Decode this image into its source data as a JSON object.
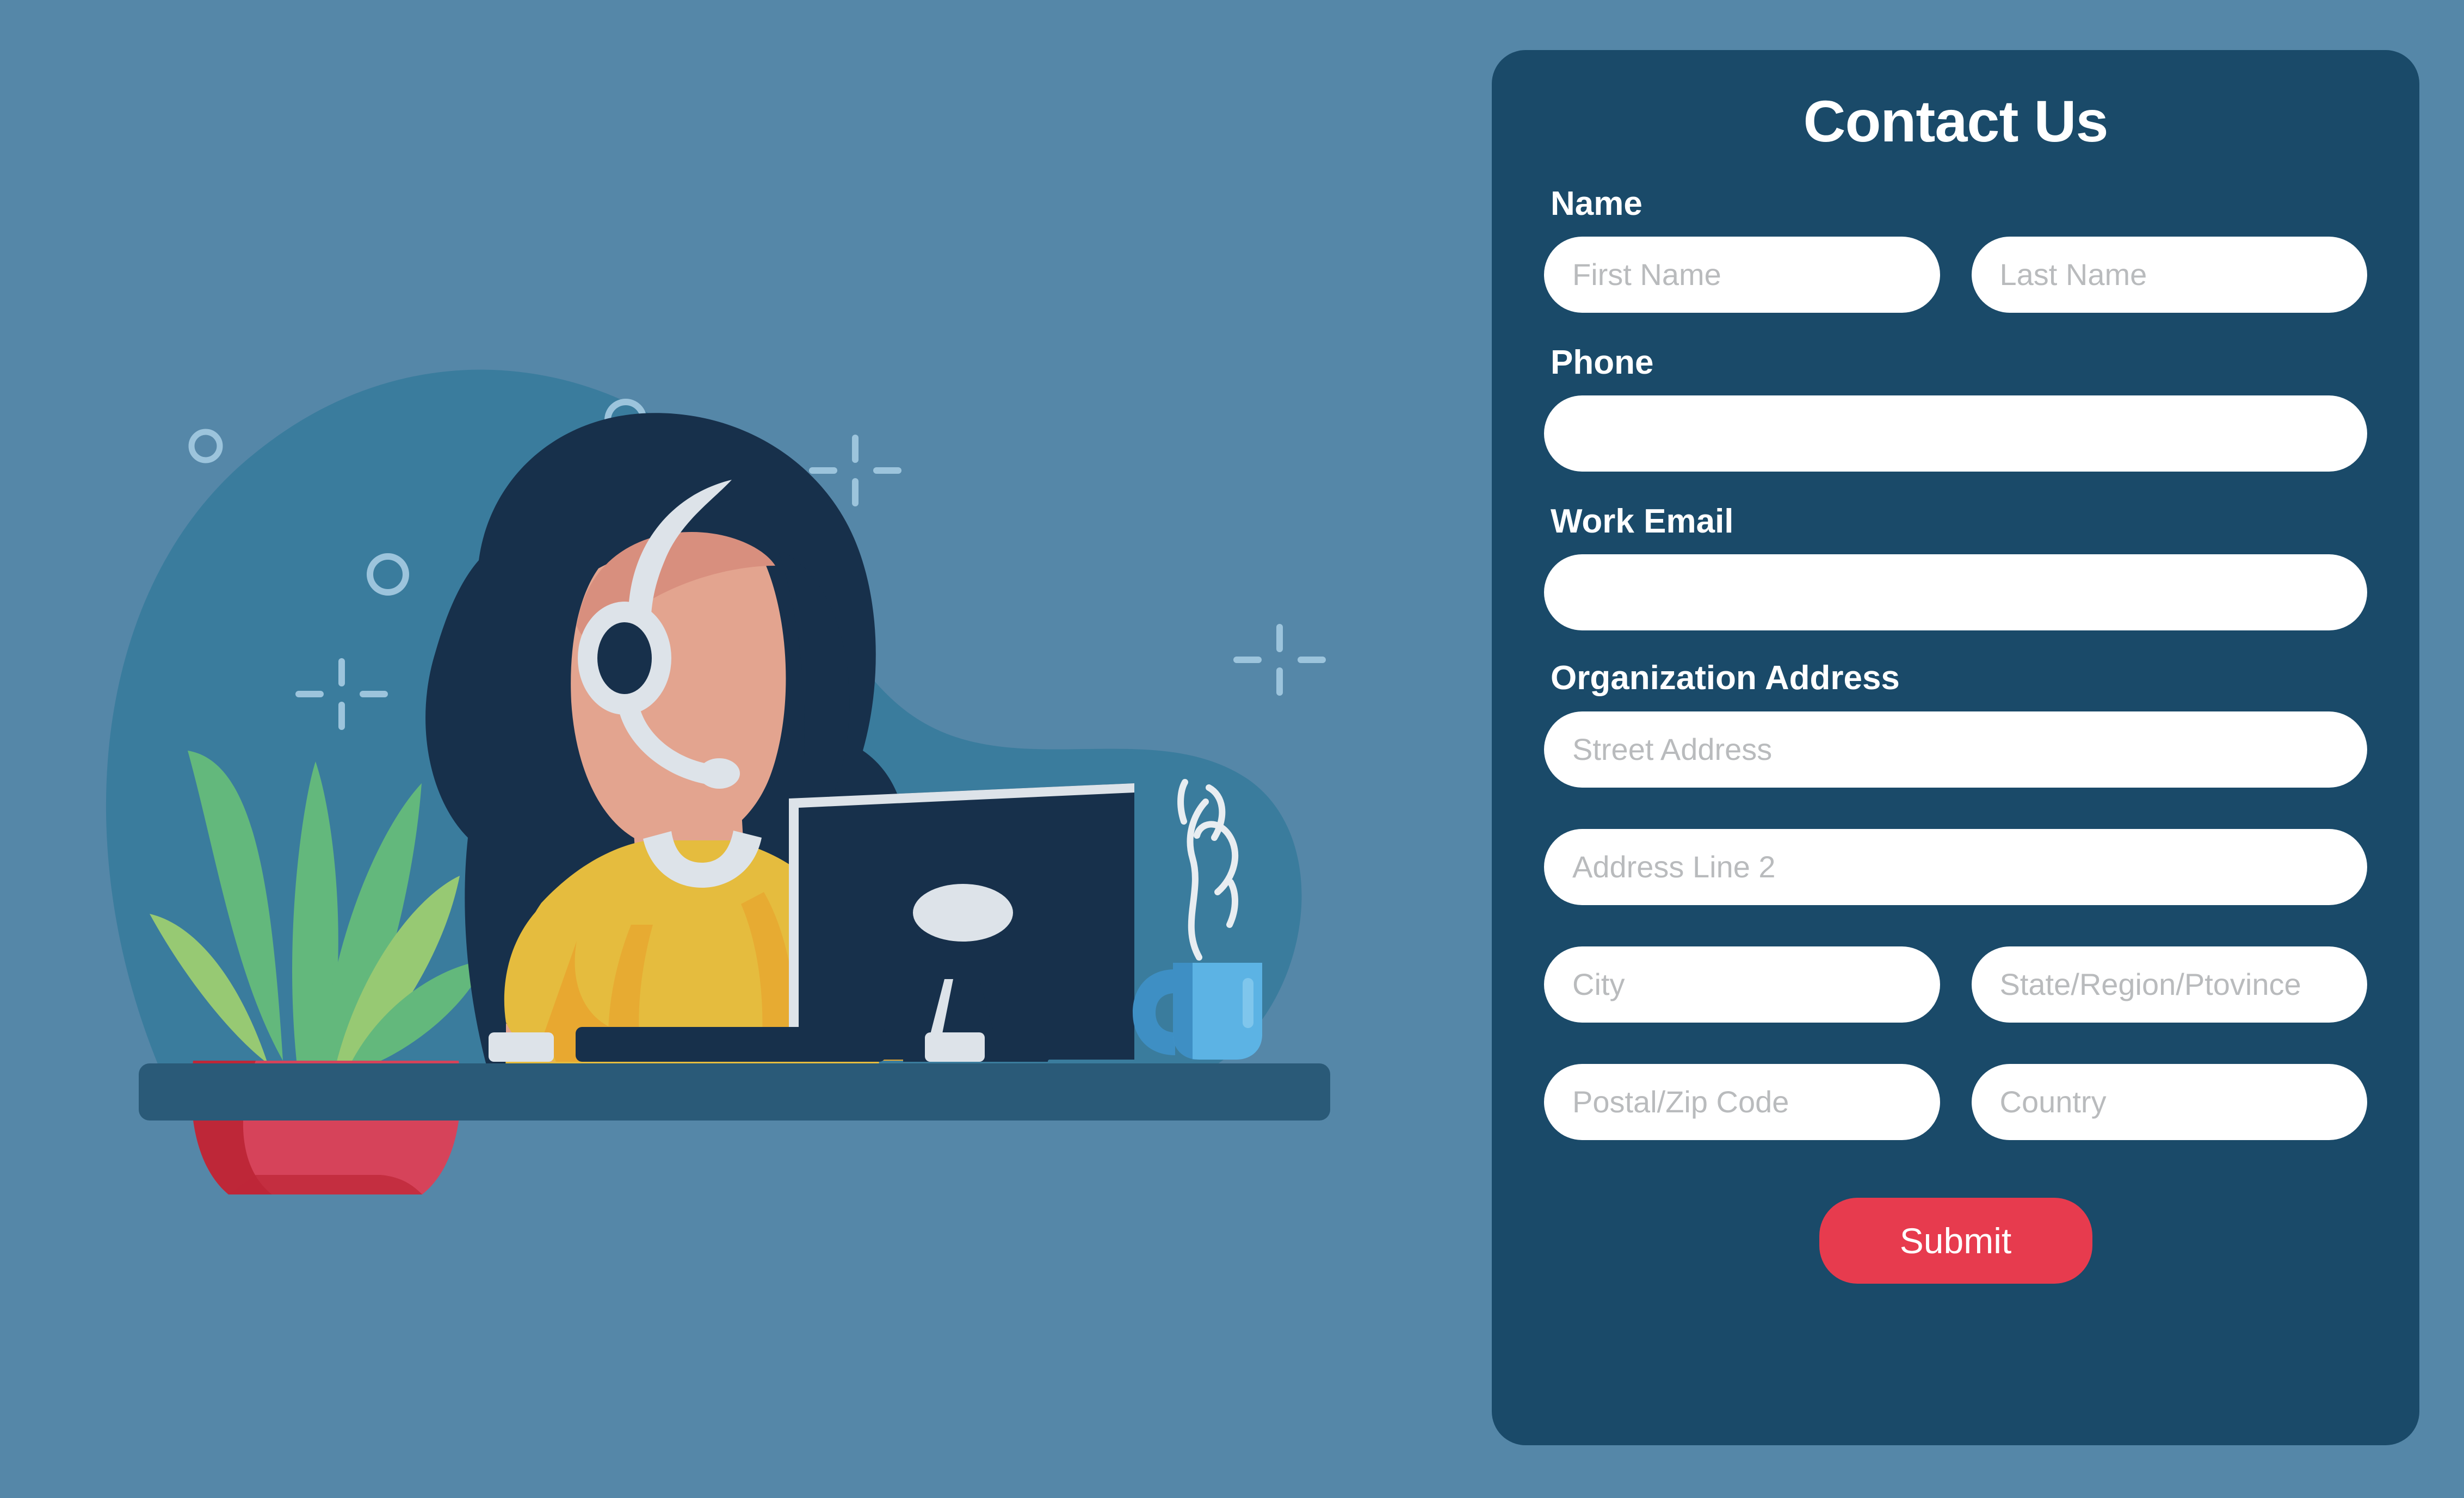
{
  "page": {
    "background_color": "#5587A8"
  },
  "illustration": {
    "name": "customer-support-agent-illustration",
    "description": "Flat illustration of a woman wearing a headset working at a desktop computer, with a potted plant on the left and a steaming coffee mug on the right",
    "colors": {
      "page_bg": "#5587A8",
      "blob_bg": "#3A7C9D",
      "desk": "#2A5A78",
      "hair": "#17304B",
      "skin": "#E3A48F",
      "skin_shadow": "#D88F7E",
      "sweater": "#E5BC3E",
      "sweater_shadow": "#E8A830",
      "headset": "#DDE3E9",
      "monitor": "#17304B",
      "monitor_edge": "#DDE3E9",
      "plant_leaf_dark": "#63B87C",
      "plant_leaf_light": "#97C973",
      "pot": "#D6435A",
      "pot_shadow": "#BE2738",
      "mug": "#5CB3E4",
      "mug_shadow": "#3E8FC4",
      "steam": "#E8EDF1",
      "accent_marks": "#9CC4DC"
    },
    "elements": [
      "background-blob",
      "decorative-circles",
      "decorative-cross-marks",
      "potted-plant",
      "woman-with-headset",
      "desktop-monitor",
      "keyboard",
      "mouse",
      "coffee-mug",
      "steam",
      "desk"
    ]
  },
  "form": {
    "title": "Contact Us",
    "accent_color": "#E73B4E",
    "panel_color": "#1A4A69",
    "groups": [
      {
        "label": "Name",
        "rows": [
          [
            {
              "name": "first-name",
              "placeholder": "First Name",
              "value": ""
            },
            {
              "name": "last-name",
              "placeholder": "Last Name",
              "value": ""
            }
          ]
        ]
      },
      {
        "label": "Phone",
        "rows": [
          [
            {
              "name": "phone",
              "placeholder": "",
              "value": ""
            }
          ]
        ]
      },
      {
        "label": "Work Email",
        "rows": [
          [
            {
              "name": "work-email",
              "placeholder": "",
              "value": ""
            }
          ]
        ]
      },
      {
        "label": "Organization Address",
        "rows": [
          [
            {
              "name": "street-address",
              "placeholder": "Street Address",
              "value": ""
            }
          ],
          [
            {
              "name": "address-line-2",
              "placeholder": "Address Line 2",
              "value": ""
            }
          ],
          [
            {
              "name": "city",
              "placeholder": "City",
              "value": ""
            },
            {
              "name": "state-region-province",
              "placeholder": "State/Region/Ptovince",
              "value": ""
            }
          ],
          [
            {
              "name": "postal-zip-code",
              "placeholder": "Postal/Zip Code",
              "value": ""
            },
            {
              "name": "country",
              "placeholder": "Country",
              "value": ""
            }
          ]
        ]
      }
    ],
    "submit_label": "Submit"
  }
}
